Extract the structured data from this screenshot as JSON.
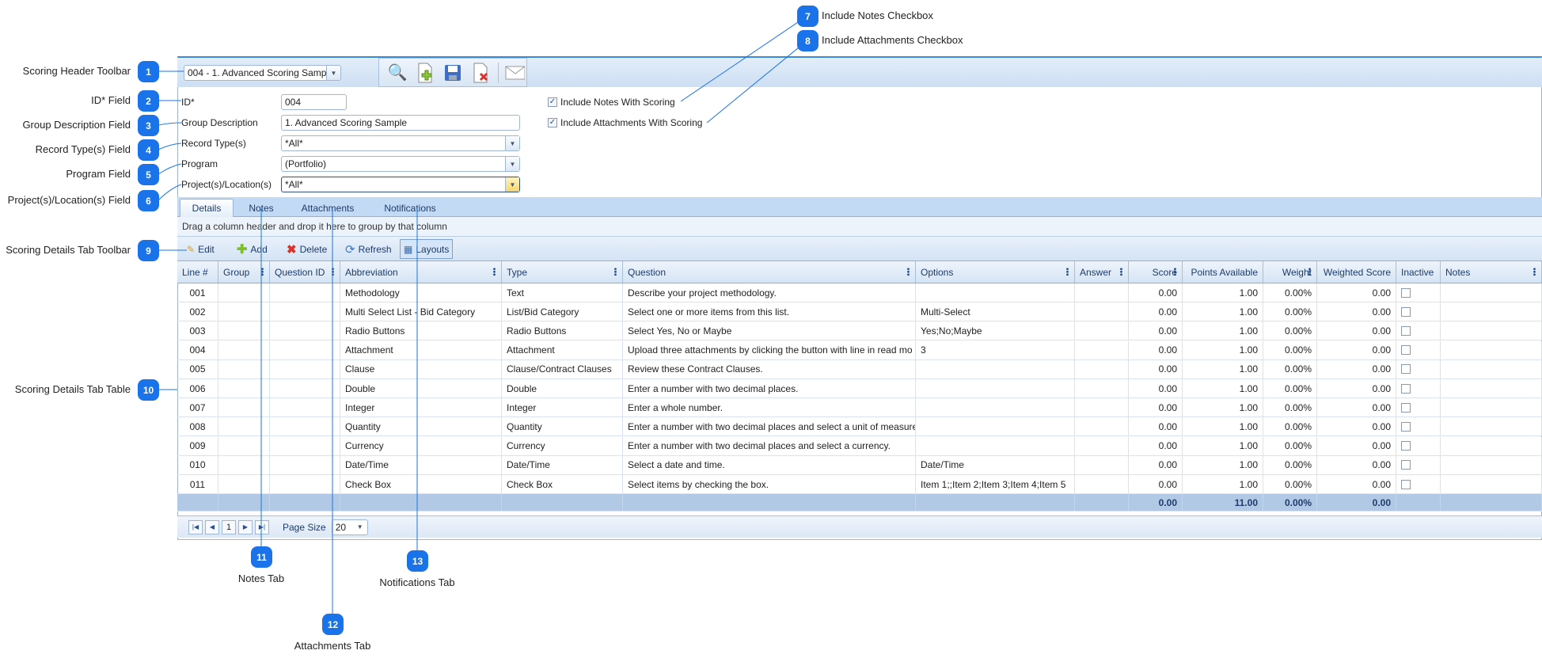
{
  "header_toolbar": {
    "record_select": "004 - 1. Advanced Scoring Sampl",
    "icons": [
      "search-icon",
      "new-document-icon",
      "save-icon",
      "delete-document-icon",
      "email-icon"
    ]
  },
  "form": {
    "id_label": "ID*",
    "id_value": "004",
    "group_desc_label": "Group Description",
    "group_desc_value": "1. Advanced Scoring Sample",
    "record_types_label": "Record Type(s)",
    "record_types_value": "*All*",
    "program_label": "Program",
    "program_value": "(Portfolio)",
    "projects_label": "Project(s)/Location(s)",
    "projects_value": "*All*",
    "include_notes_label": "Include Notes With Scoring",
    "include_notes_checked": true,
    "include_attachments_label": "Include Attachments With Scoring",
    "include_attachments_checked": true
  },
  "tabs": [
    "Details",
    "Notes",
    "Attachments",
    "Notifications"
  ],
  "active_tab": "Details",
  "group_bar": "Drag a column header and drop it here to group by that column",
  "grid_toolbar": {
    "edit": "Edit",
    "add": "Add",
    "delete": "Delete",
    "refresh": "Refresh",
    "layouts": "Layouts"
  },
  "grid": {
    "columns": [
      "Line #",
      "Group",
      "Question ID",
      "Abbreviation",
      "Type",
      "Question",
      "Options",
      "Answer",
      "Score",
      "Points Available",
      "Weight",
      "Weighted Score",
      "Inactive",
      "Notes"
    ],
    "rows": [
      [
        "001",
        "",
        "",
        "Methodology",
        "Text",
        "Describe your project methodology.",
        "",
        "",
        "0.00",
        "1.00",
        "0.00%",
        "0.00",
        false,
        ""
      ],
      [
        "002",
        "",
        "",
        "Multi Select List - Bid Category",
        "List/Bid Category",
        "Select one or more items from this list.",
        "Multi-Select",
        "",
        "0.00",
        "1.00",
        "0.00%",
        "0.00",
        false,
        ""
      ],
      [
        "003",
        "",
        "",
        "Radio Buttons",
        "Radio Buttons",
        "Select Yes, No or Maybe",
        "Yes;No;Maybe",
        "",
        "0.00",
        "1.00",
        "0.00%",
        "0.00",
        false,
        ""
      ],
      [
        "004",
        "",
        "",
        "Attachment",
        "Attachment",
        "Upload three attachments by clicking the button with line in read mo",
        "3",
        "",
        "0.00",
        "1.00",
        "0.00%",
        "0.00",
        false,
        ""
      ],
      [
        "005",
        "",
        "",
        "Clause",
        "Clause/Contract Clauses",
        "Review these Contract Clauses.",
        "",
        "",
        "0.00",
        "1.00",
        "0.00%",
        "0.00",
        false,
        ""
      ],
      [
        "006",
        "",
        "",
        "Double",
        "Double",
        "Enter a number with two decimal places.",
        "",
        "",
        "0.00",
        "1.00",
        "0.00%",
        "0.00",
        false,
        ""
      ],
      [
        "007",
        "",
        "",
        "Integer",
        "Integer",
        "Enter a whole number.",
        "",
        "",
        "0.00",
        "1.00",
        "0.00%",
        "0.00",
        false,
        ""
      ],
      [
        "008",
        "",
        "",
        "Quantity",
        "Quantity",
        "Enter a number with two decimal places and select a unit of measure",
        "",
        "",
        "0.00",
        "1.00",
        "0.00%",
        "0.00",
        false,
        ""
      ],
      [
        "009",
        "",
        "",
        "Currency",
        "Currency",
        "Enter a number with two decimal places and select a currency.",
        "",
        "",
        "0.00",
        "1.00",
        "0.00%",
        "0.00",
        false,
        ""
      ],
      [
        "010",
        "",
        "",
        "Date/Time",
        "Date/Time",
        "Select a date and time.",
        "Date/Time",
        "",
        "0.00",
        "1.00",
        "0.00%",
        "0.00",
        false,
        ""
      ],
      [
        "011",
        "",
        "",
        "Check Box",
        "Check Box",
        "Select items by checking the box.",
        "Item 1;;Item 2;Item 3;Item 4;Item 5",
        "",
        "0.00",
        "1.00",
        "0.00%",
        "0.00",
        false,
        ""
      ]
    ],
    "totals": {
      "score": "0.00",
      "points_available": "11.00",
      "weight": "0.00%",
      "weighted_score": "0.00"
    }
  },
  "pager": {
    "current_page": "1",
    "page_size_label": "Page Size",
    "page_size": "20"
  },
  "callouts": [
    {
      "n": "1",
      "label": "Scoring Header Toolbar"
    },
    {
      "n": "2",
      "label": "ID* Field"
    },
    {
      "n": "3",
      "label": "Group Description Field"
    },
    {
      "n": "4",
      "label": "Record Type(s) Field"
    },
    {
      "n": "5",
      "label": "Program Field"
    },
    {
      "n": "6",
      "label": "Project(s)/Location(s) Field"
    },
    {
      "n": "7",
      "label": "Include Notes Checkbox"
    },
    {
      "n": "8",
      "label": "Include Attachments Checkbox"
    },
    {
      "n": "9",
      "label": "Scoring Details Tab Toolbar"
    },
    {
      "n": "10",
      "label": "Scoring Details Tab Table"
    },
    {
      "n": "11",
      "label": "Notes Tab"
    },
    {
      "n": "12",
      "label": "Attachments Tab"
    },
    {
      "n": "13",
      "label": "Notifications Tab"
    }
  ],
  "colors": {
    "accent": "#1a73e8",
    "header_band": "#c3daf5",
    "footer_row": "#b2c9e6"
  }
}
